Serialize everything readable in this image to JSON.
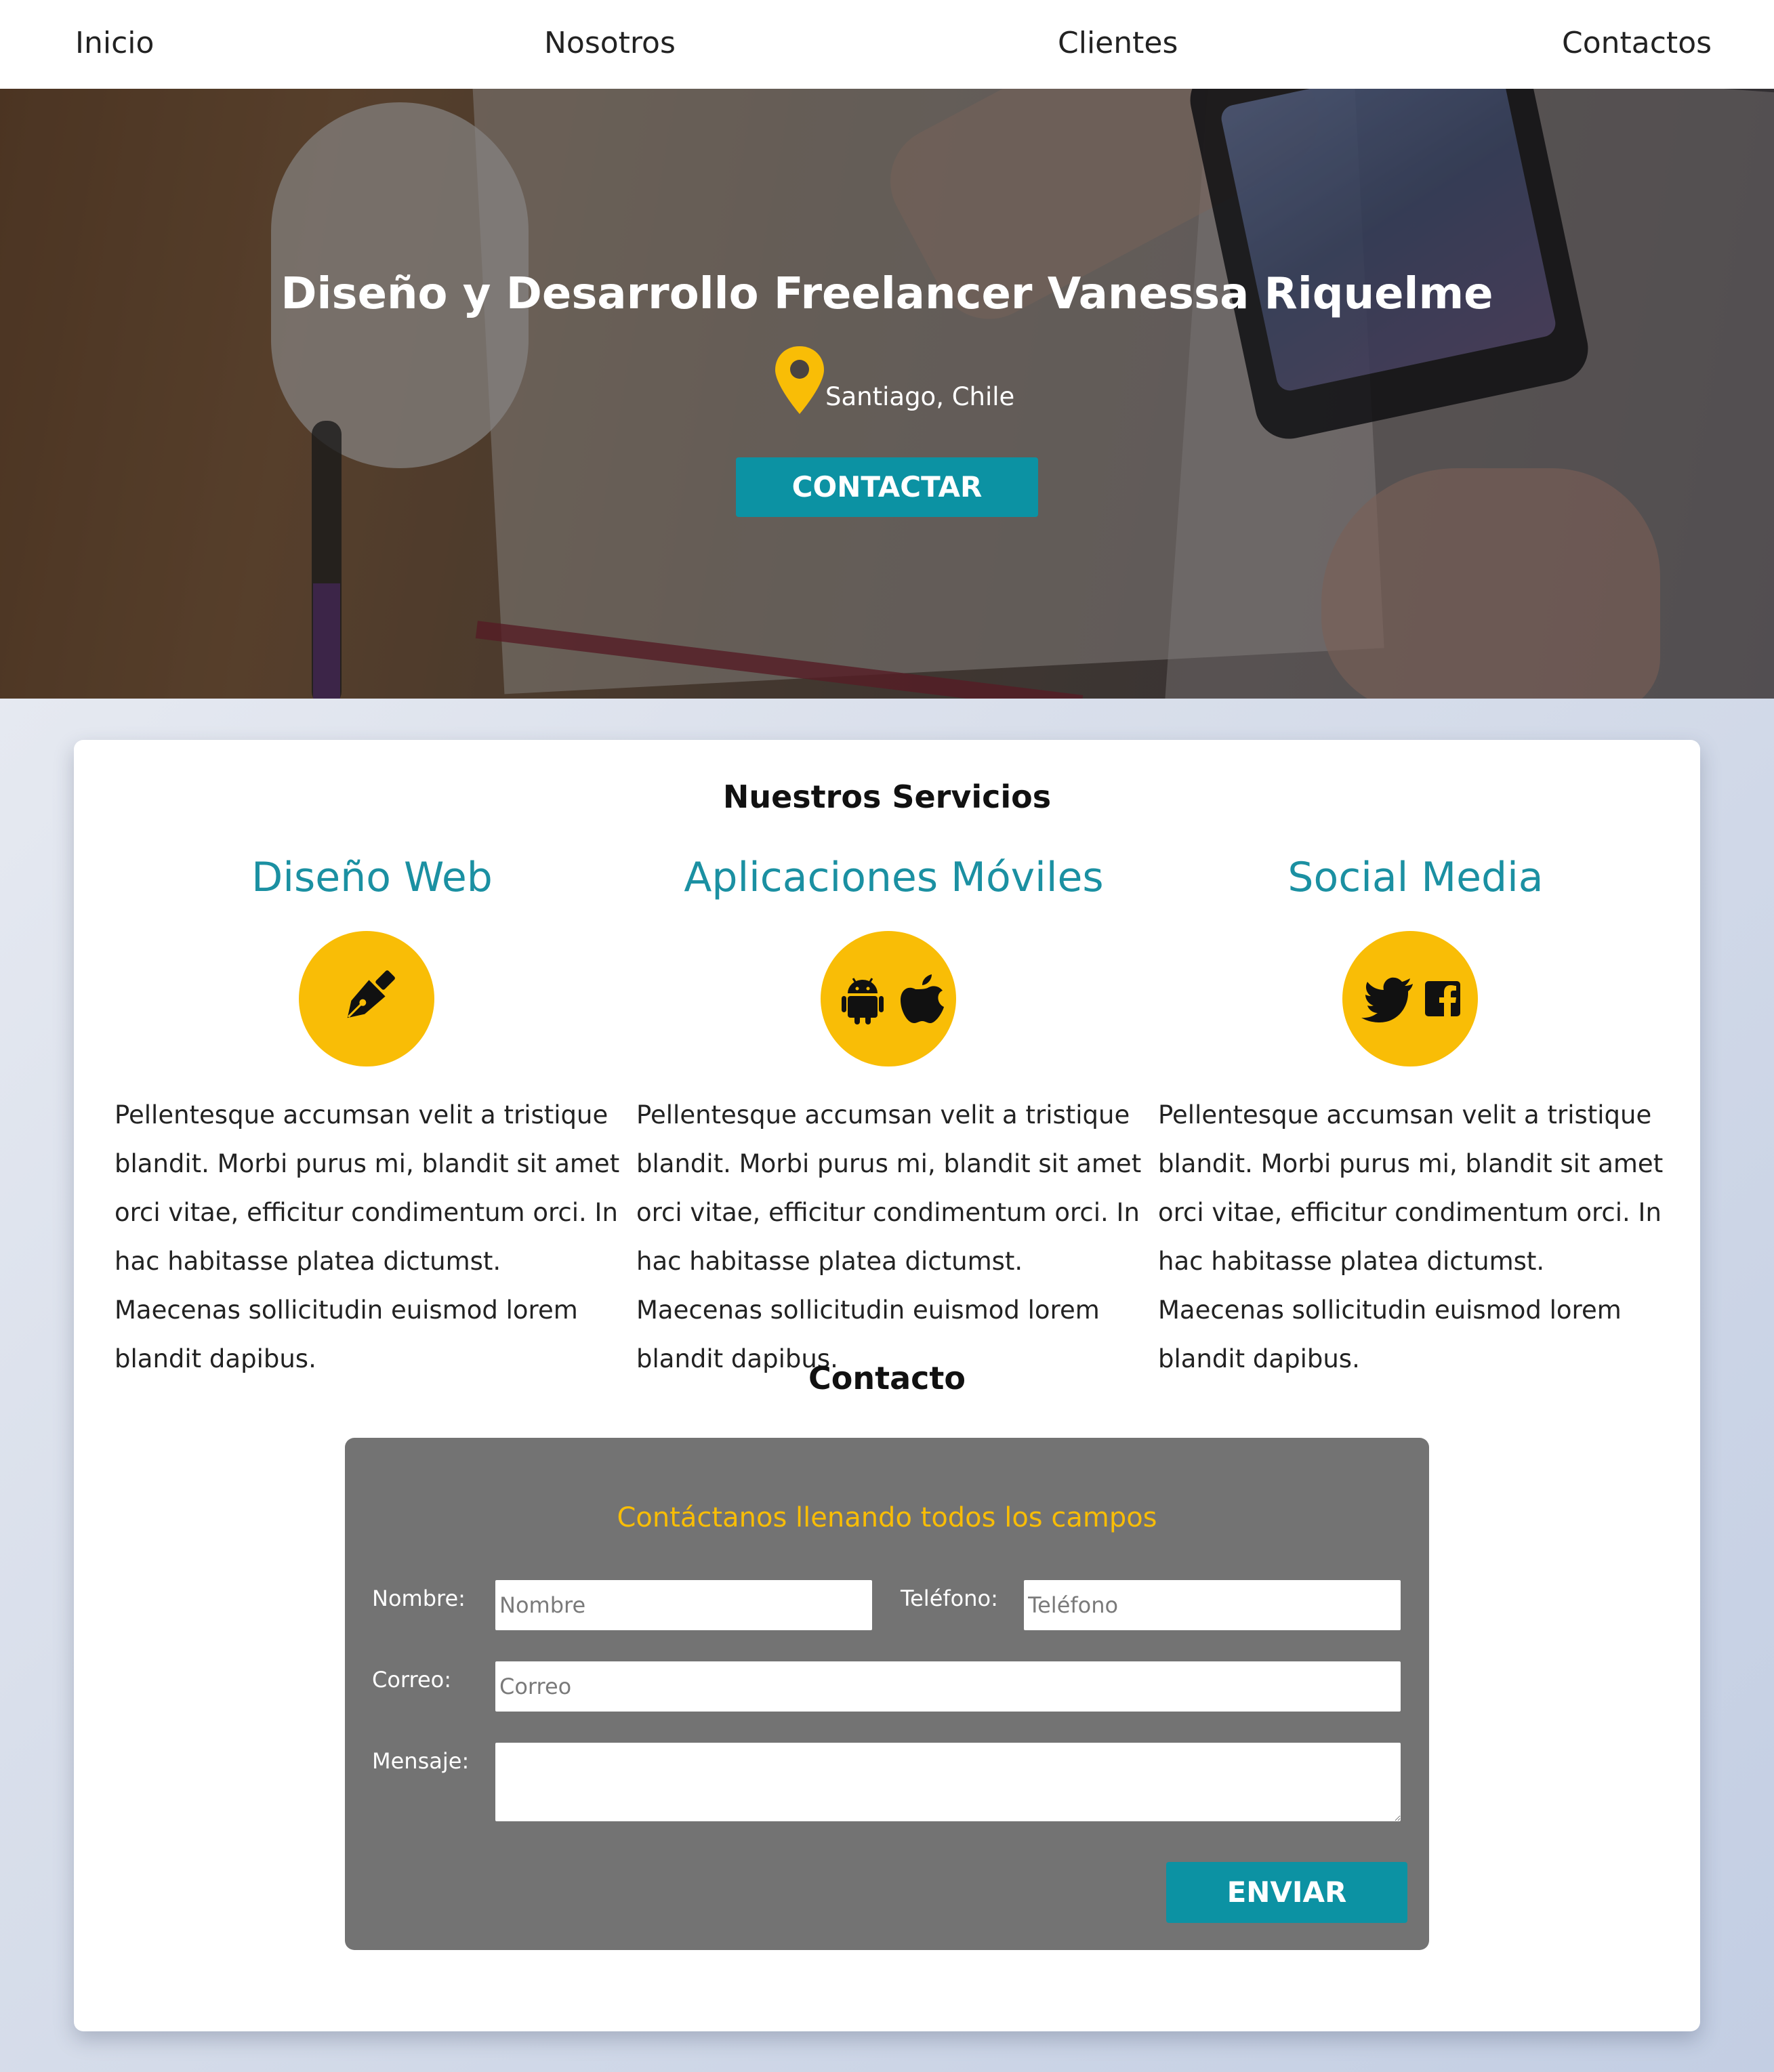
{
  "nav": {
    "items": [
      "Inicio",
      "Nosotros",
      "Clientes",
      "Contactos"
    ]
  },
  "hero": {
    "title": "Diseño y Desarrollo Freelancer Vanessa Riquelme",
    "location": "Santiago, Chile",
    "location_icon": "map-pin-icon",
    "button_label": "CONTACTAR"
  },
  "services": {
    "title": "Nuestros Servicios",
    "items": [
      {
        "title": "Diseño Web",
        "icons": [
          "pen-nib-icon"
        ],
        "text": "Pellentesque accumsan velit a tristique blandit. Morbi purus mi, blandit sit amet orci vitae, efficitur condimentum orci. In hac habitasse platea dictumst. Maecenas sollicitudin euismod lorem blandit dapibus."
      },
      {
        "title": "Aplicaciones Móviles",
        "icons": [
          "android-icon",
          "apple-icon"
        ],
        "text": "Pellentesque accumsan velit a tristique blandit. Morbi purus mi, blandit sit amet orci vitae, efficitur condimentum orci. In hac habitasse platea dictumst. Maecenas sollicitudin euismod lorem blandit dapibus."
      },
      {
        "title": "Social Media",
        "icons": [
          "twitter-icon",
          "facebook-icon"
        ],
        "text": "Pellentesque accumsan velit a tristique blandit. Morbi purus mi, blandit sit amet orci vitae, efficitur condimentum orci. In hac habitasse platea dictumst. Maecenas sollicitudin euismod lorem blandit dapibus."
      }
    ]
  },
  "contact": {
    "title": "Contacto",
    "form_heading": "Contáctanos llenando todos los campos",
    "name_label": "Nombre:",
    "name_placeholder": "Nombre",
    "phone_label": "Teléfono:",
    "phone_placeholder": "Teléfono",
    "email_label": "Correo:",
    "email_placeholder": "Correo",
    "message_label": "Mensaje:",
    "message_value": "",
    "submit_label": "ENVIAR"
  },
  "colors": {
    "accent_teal": "#0c92a3",
    "accent_yellow": "#f9bd06",
    "form_bg": "#737373"
  }
}
